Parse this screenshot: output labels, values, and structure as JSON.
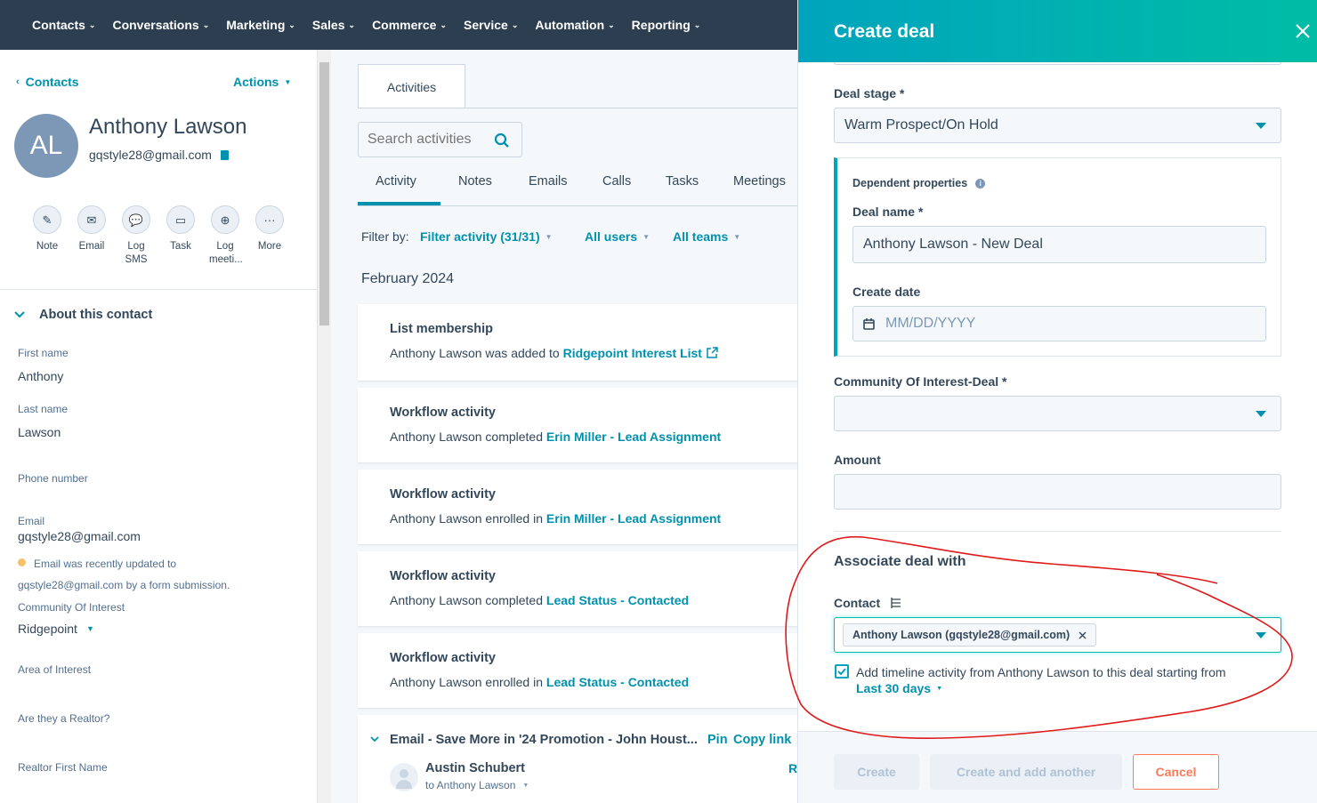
{
  "nav": {
    "items": [
      "Contacts",
      "Conversations",
      "Marketing",
      "Sales",
      "Commerce",
      "Service",
      "Automation",
      "Reporting"
    ]
  },
  "contact": {
    "back_label": "Contacts",
    "actions_label": "Actions",
    "initials": "AL",
    "name": "Anthony Lawson",
    "email": "gqstyle28@gmail.com",
    "quick_actions": [
      {
        "label": "Note",
        "icon": "note-icon"
      },
      {
        "label": "Email",
        "icon": "email-icon"
      },
      {
        "label": "Log SMS",
        "icon": "sms-icon"
      },
      {
        "label": "Task",
        "icon": "task-icon"
      },
      {
        "label": "Log meeti...",
        "icon": "meeting-icon"
      },
      {
        "label": "More",
        "icon": "more-icon"
      }
    ],
    "about_title": "About this contact",
    "properties": {
      "first_name_label": "First name",
      "first_name": "Anthony",
      "last_name_label": "Last name",
      "last_name": "Lawson",
      "phone_label": "Phone number",
      "email_label": "Email",
      "email_value": "gqstyle28@gmail.com",
      "email_note_1": "Email was recently updated to",
      "email_note_2": "gqstyle28@gmail.com by a form submission.",
      "community_label": "Community Of Interest",
      "community_value": "Ridgepoint",
      "area_label": "Area of Interest",
      "realtor_label": "Are they a Realtor?",
      "realtor_first_label": "Realtor First Name"
    }
  },
  "activities": {
    "tab_label": "Activities",
    "search_placeholder": "Search activities",
    "subtabs": [
      "Activity",
      "Notes",
      "Emails",
      "Calls",
      "Tasks",
      "Meetings"
    ],
    "filter_by_label": "Filter by:",
    "filter_activity": "Filter activity (31/31)",
    "all_users": "All users",
    "all_teams": "All teams",
    "month": "February 2024",
    "cards": [
      {
        "title": "List membership",
        "prefix": "Anthony Lawson was added to ",
        "link": "Ridgepoint Interest List"
      },
      {
        "title": "Workflow activity",
        "prefix": "Anthony Lawson completed ",
        "link": "Erin Miller - Lead Assignment"
      },
      {
        "title": "Workflow activity",
        "prefix": "Anthony Lawson enrolled in ",
        "link": "Erin Miller - Lead Assignment"
      },
      {
        "title": "Workflow activity",
        "prefix": "Anthony Lawson completed ",
        "link": "Lead Status - Contacted"
      },
      {
        "title": "Workflow activity",
        "prefix": "Anthony Lawson enrolled in ",
        "link": "Lead Status - Contacted"
      }
    ],
    "email_card": {
      "title": "Email - Save More in '24 Promotion - John Houst...",
      "pin": "Pin",
      "copy_link": "Copy link",
      "sender": "Austin Schubert",
      "to": "to Anthony Lawson",
      "trailing": "R"
    }
  },
  "deal": {
    "title": "Create deal",
    "deal_stage_label": "Deal stage *",
    "deal_stage_value": "Warm Prospect/On Hold",
    "dependent_label": "Dependent properties",
    "deal_name_label": "Deal name *",
    "deal_name_value": "Anthony Lawson - New Deal",
    "create_date_label": "Create date",
    "create_date_placeholder": "MM/DD/YYYY",
    "community_label": "Community Of Interest-Deal *",
    "amount_label": "Amount",
    "associate_title": "Associate deal with",
    "contact_label": "Contact",
    "contact_chip": "Anthony Lawson (gqstyle28@gmail.com)",
    "timeline_text": "Add timeline activity from Anthony Lawson to this deal starting from",
    "timeline_period": "Last 30 days",
    "buttons": {
      "create": "Create",
      "create_another": "Create and add another",
      "cancel": "Cancel"
    }
  },
  "colors": {
    "nav_bg": "#2d3e50",
    "accent": "#0091ae",
    "header_gradient_start": "#00a4bd",
    "header_gradient_end": "#00bda5",
    "cancel": "#ff7a59",
    "annotation": "#e0191b"
  }
}
